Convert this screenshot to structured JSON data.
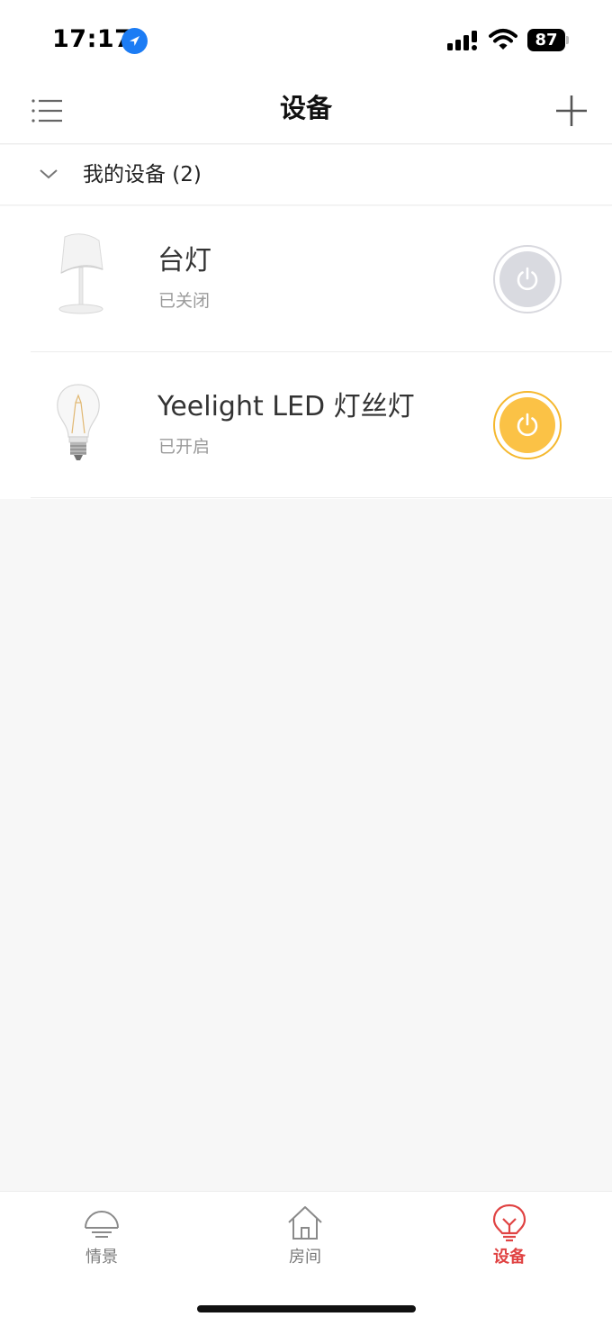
{
  "status_bar": {
    "time": "17:17",
    "battery": "87",
    "icons": [
      "location-arrow-icon",
      "cellular-signal-icon",
      "wifi-icon",
      "battery-icon"
    ]
  },
  "header": {
    "title": "设备",
    "menu_icon": "list-menu-icon",
    "add_icon": "plus-icon"
  },
  "group": {
    "label": "我的设备 (2)",
    "icon": "chevron-down-icon"
  },
  "devices": [
    {
      "name": "台灯",
      "status": "已关闭",
      "power": "off",
      "image": "desk-lamp-image"
    },
    {
      "name": "Yeelight LED 灯丝灯",
      "status": "已开启",
      "power": "on",
      "image": "filament-bulb-image"
    }
  ],
  "tabs": [
    {
      "label": "情景",
      "icon": "scene-lamp-icon",
      "active": false
    },
    {
      "label": "房间",
      "icon": "house-icon",
      "active": false
    },
    {
      "label": "设备",
      "icon": "bulb-icon",
      "active": true
    }
  ],
  "colors": {
    "accent": "#e04343",
    "power_on": "#fbc246",
    "power_off": "#d9dae0",
    "location_blue": "#1c7cf4"
  }
}
